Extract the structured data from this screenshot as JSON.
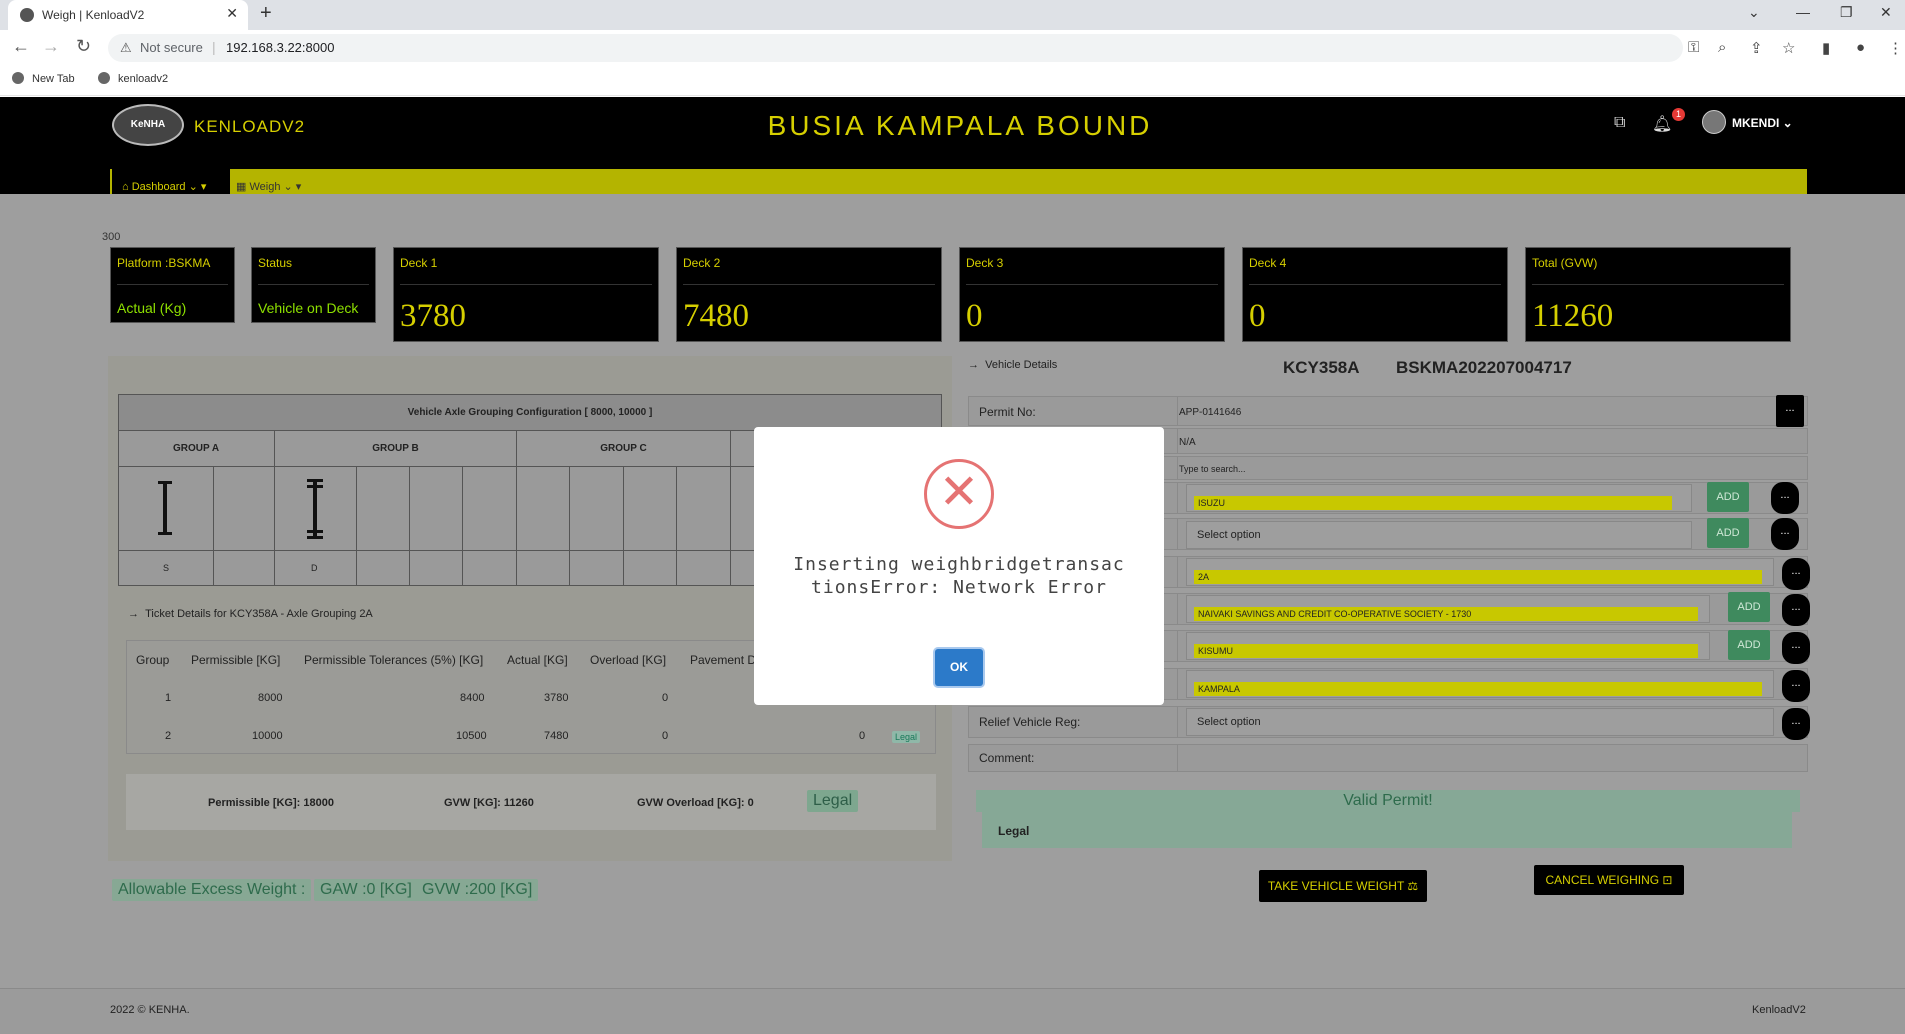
{
  "browser": {
    "tab_title": "Weigh | KenloadV2",
    "not_secure": "Not secure",
    "url": "192.168.3.22:8000",
    "bookmarks": [
      "New Tab",
      "kenloadv2"
    ]
  },
  "header": {
    "logo_text": "KeNHA",
    "brand": "KENLOADV2",
    "title": "BUSIA KAMPALA BOUND",
    "notification_count": "1",
    "username": "MKENDI"
  },
  "nav": {
    "dashboard": "Dashboard",
    "weigh": "Weigh"
  },
  "top_number": "300",
  "cards": {
    "platform": {
      "title": "Platform :BSKMA",
      "sub": "Actual (Kg)"
    },
    "status": {
      "title": "Status",
      "sub": "Vehicle on Deck"
    },
    "deck1": {
      "title": "Deck 1",
      "value": "3780"
    },
    "deck2": {
      "title": "Deck 2",
      "value": "7480"
    },
    "deck3": {
      "title": "Deck 3",
      "value": "0"
    },
    "deck4": {
      "title": "Deck 4",
      "value": "0"
    },
    "total": {
      "title": "Total (GVW)",
      "value": "11260"
    }
  },
  "axle": {
    "title": "Vehicle Axle Grouping Configuration [ 8000, 10000 ]",
    "groups": [
      "GROUP A",
      "GROUP B",
      "GROUP C"
    ],
    "labels": [
      "S",
      "D"
    ]
  },
  "ticket": {
    "title": "Ticket Details for KCY358A - Axle Grouping 2A",
    "headers": [
      "Group",
      "Permissible [KG]",
      "Permissible Tolerances (5%) [KG]",
      "Actual [KG]",
      "Overload [KG]",
      "Pavement D"
    ],
    "rows": [
      [
        "1",
        "8000",
        "8400",
        "3780",
        "0"
      ],
      [
        "2",
        "10000",
        "10500",
        "7480",
        "0",
        "0"
      ]
    ],
    "row_status": "Legal"
  },
  "summary": {
    "permissible": "Permissible [KG]: 18000",
    "gvw": "GVW [KG]: 11260",
    "gvw_overload": "GVW Overload [KG]: 0",
    "status": "Legal"
  },
  "allowable": {
    "label": "Allowable Excess Weight :",
    "gaw": "GAW :0 [KG]",
    "gvw": "GVW :200 [KG]"
  },
  "vehicle": {
    "section_title": "Vehicle Details",
    "plate": "KCY358A",
    "ticket_no": "BSKMA202207004717",
    "permit_label": "Permit No:",
    "permit_value": "APP-0141646",
    "na": "N/A",
    "search_placeholder": "Type to search...",
    "make": "ISUZU",
    "select_option": "Select option",
    "axle_config": "2A",
    "transporter": "NAIVAKI SAVINGS AND CREDIT CO-OPERATIVE SOCIETY - 1730",
    "origin": "KISUMU",
    "destination": "KAMPALA",
    "relief_label": "Relief Vehicle Reg:",
    "relief_value": "Select option",
    "comment_label": "Comment:",
    "add": "ADD",
    "dots": "...",
    "valid_permit": "Valid Permit!",
    "legal": "Legal",
    "take_weight": "TAKE VEHICLE WEIGHT ⚖",
    "cancel": "CANCEL WEIGHING ⊡"
  },
  "footer": {
    "copyright": "2022 © KENHA.",
    "brand": "KenloadV2"
  },
  "modal": {
    "message": "Inserting weighbridgetransactionsError: Network Error",
    "ok": "OK"
  }
}
